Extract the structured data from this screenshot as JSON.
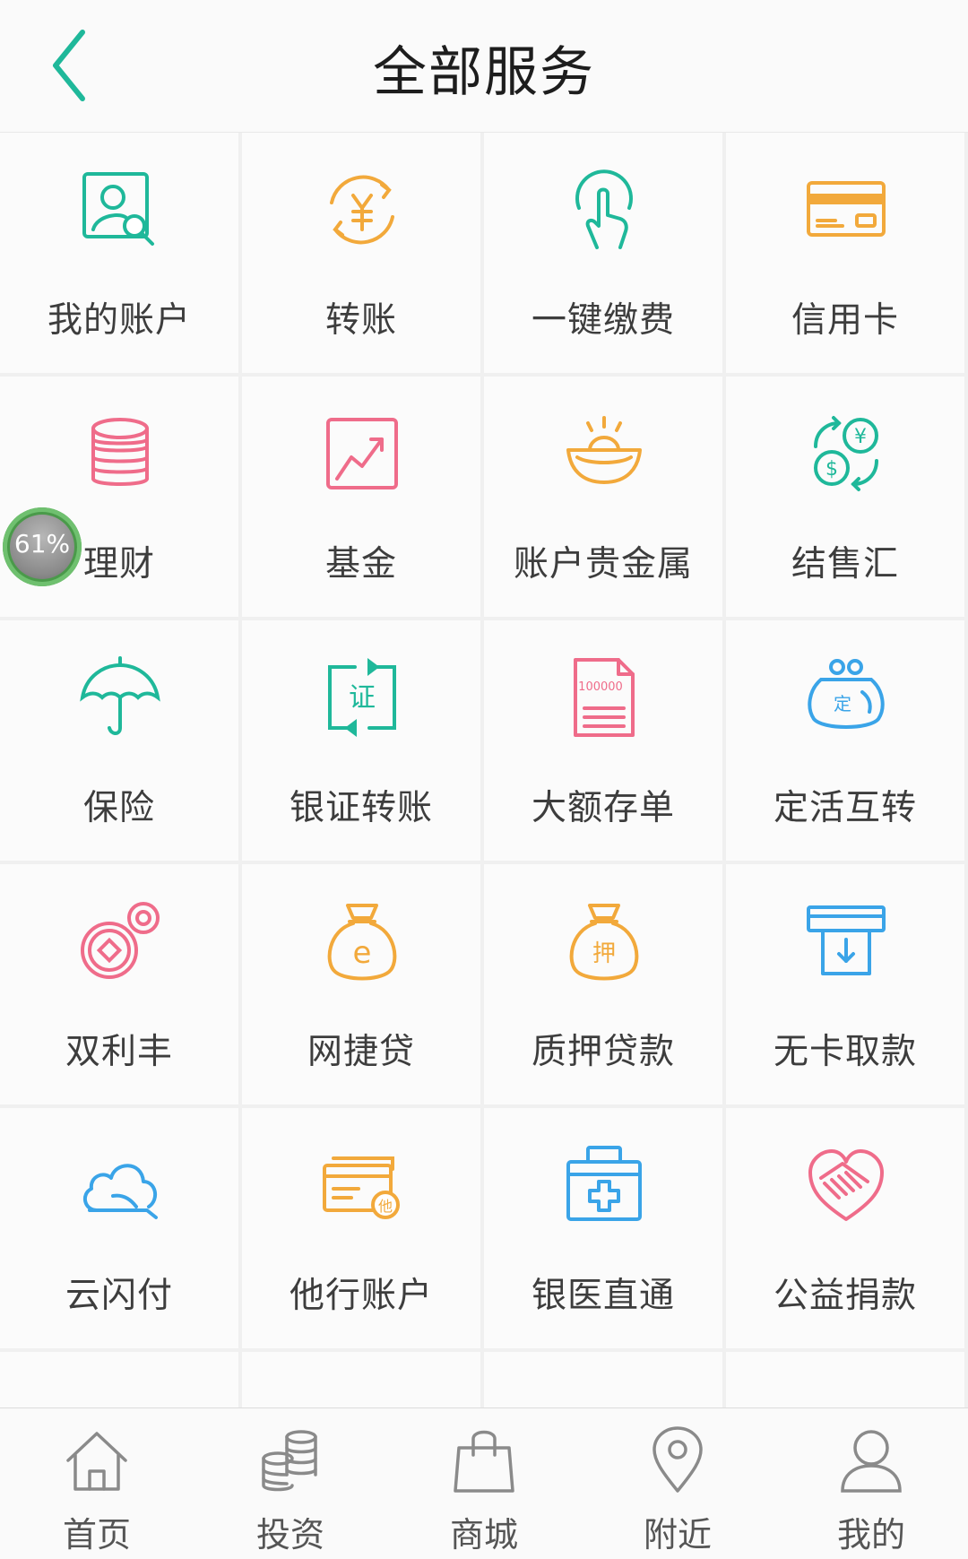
{
  "header": {
    "title": "全部服务",
    "back_icon": "chevron-left-icon",
    "accent": "#1fb89a"
  },
  "services": [
    {
      "label": "我的账户",
      "icon": "account-search-icon",
      "color": "#1fb89a"
    },
    {
      "label": "转账",
      "icon": "transfer-yuan-icon",
      "color": "#f2a93b"
    },
    {
      "label": "一键缴费",
      "icon": "tap-finger-icon",
      "color": "#1fb89a"
    },
    {
      "label": "信用卡",
      "icon": "credit-card-icon",
      "color": "#f2a93b"
    },
    {
      "label": "理财",
      "icon": "coin-stack-icon",
      "color": "#ef6c8a"
    },
    {
      "label": "基金",
      "icon": "fund-chart-icon",
      "color": "#ef6c8a"
    },
    {
      "label": "账户贵金属",
      "icon": "gold-ingot-icon",
      "color": "#f2a93b"
    },
    {
      "label": "结售汇",
      "icon": "currency-exchange-icon",
      "color": "#1fb89a"
    },
    {
      "label": "保险",
      "icon": "umbrella-icon",
      "color": "#1fb89a"
    },
    {
      "label": "银证转账",
      "icon": "securities-transfer-icon",
      "color": "#1fb89a"
    },
    {
      "label": "大额存单",
      "icon": "deposit-certificate-icon",
      "color": "#ef6c8a"
    },
    {
      "label": "定活互转",
      "icon": "purse-icon",
      "color": "#3aa4e8"
    },
    {
      "label": "双利丰",
      "icon": "coins-icon",
      "color": "#ef6c8a"
    },
    {
      "label": "网捷贷",
      "icon": "money-bag-e-icon",
      "color": "#f2a93b"
    },
    {
      "label": "质押贷款",
      "icon": "pledge-bag-icon",
      "color": "#f2a93b"
    },
    {
      "label": "无卡取款",
      "icon": "atm-withdraw-icon",
      "color": "#3aa4e8"
    },
    {
      "label": "云闪付",
      "icon": "cloud-icon",
      "color": "#3aa4e8"
    },
    {
      "label": "他行账户",
      "icon": "other-bank-card-icon",
      "color": "#f2a93b"
    },
    {
      "label": "银医直通",
      "icon": "medical-kit-icon",
      "color": "#3aa4e8"
    },
    {
      "label": "公益捐款",
      "icon": "charity-heart-icon",
      "color": "#ef6c8a"
    }
  ],
  "overlay_badge": {
    "text": "61%"
  },
  "tabbar": [
    {
      "label": "首页",
      "icon": "home-icon"
    },
    {
      "label": "投资",
      "icon": "coins-stack-icon"
    },
    {
      "label": "商城",
      "icon": "shopping-bag-icon"
    },
    {
      "label": "附近",
      "icon": "location-pin-icon"
    },
    {
      "label": "我的",
      "icon": "user-icon"
    }
  ]
}
